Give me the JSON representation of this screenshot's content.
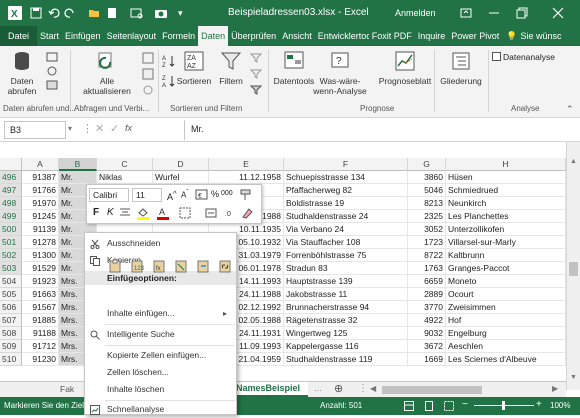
{
  "titlebar": {
    "filename": "Beispieladressen03.xlsx",
    "separator": "-",
    "app": "Excel",
    "signin": "Anmelden"
  },
  "tabs": [
    "Datei",
    "Start",
    "Einfügen",
    "Seitenlayout",
    "Formeln",
    "Daten",
    "Überprüfen",
    "Ansicht",
    "Entwicklertools",
    "Foxit PDF",
    "Inquire",
    "Power Pivot"
  ],
  "tellme": "Sie wünsc",
  "ribbon": {
    "get_data": "Daten abrufen",
    "refresh_all_line1": "Alle",
    "refresh_all_line2": "aktualisieren",
    "sort": "Sortieren",
    "filter": "Filtern",
    "datatools": "Datentools",
    "whatif_line1": "Was-wäre-",
    "whatif_line2": "wenn-Analyse",
    "forecast": "Prognoseblatt",
    "outline": "Gliederung",
    "dataanalysis": "Datenanalyse",
    "groups": [
      "Daten abrufen und...",
      "Abfragen und Verbi...",
      "Sortieren und Filtern",
      "Prognose",
      "Analyse"
    ]
  },
  "formulabar": {
    "namebox": "B3",
    "fx": "fx",
    "content": "Mr."
  },
  "columns": [
    "A",
    "B",
    "C",
    "D",
    "E",
    "F",
    "G",
    "H"
  ],
  "rows": [
    {
      "num": "496",
      "a": "91387",
      "b": "Mr.",
      "c": "Niklas",
      "d": "Wurfel",
      "e": "11.12.1958",
      "f": "Schuepisstrasse 134",
      "g": "3860",
      "h": "Hüsen"
    },
    {
      "num": "497",
      "a": "91766",
      "b": "Mr.",
      "c": "",
      "d": "",
      "e": "",
      "f": "Pfaffacherweg 82",
      "g": "5046",
      "h": "Schmiedrued"
    },
    {
      "num": "498",
      "a": "91970",
      "b": "Mr.",
      "c": "",
      "d": "",
      "e": "",
      "f": "Boldistrasse 19",
      "g": "8213",
      "h": "Neunkirch"
    },
    {
      "num": "499",
      "a": "91245",
      "b": "Mr.",
      "c": "Bernd",
      "d": "Zimmer",
      "e": "01.03.1988",
      "f": "Studhaldenstrasse 24",
      "g": "2325",
      "h": "Les Planchettes"
    },
    {
      "num": "500",
      "a": "91139",
      "b": "Mr.",
      "c": "",
      "d": "",
      "e": "10.11.1935",
      "f": "Via Verbano 24",
      "g": "3052",
      "h": "Unterzollikofen"
    },
    {
      "num": "501",
      "a": "91278",
      "b": "Mr.",
      "c": "",
      "d": "",
      "e": "05.10.1932",
      "f": "Via Stauffacher 108",
      "g": "1723",
      "h": "Villarsel-sur-Marly"
    },
    {
      "num": "502",
      "a": "91300",
      "b": "Mr.",
      "c": "",
      "d": "",
      "e": "31.03.1979",
      "f": "Forrenböhlstrasse 75",
      "g": "8722",
      "h": "Kaltbrunn"
    },
    {
      "num": "503",
      "a": "91529",
      "b": "Mr.",
      "c": "",
      "d": "",
      "e": "06.01.1978",
      "f": "Stradun 83",
      "g": "1763",
      "h": "Granges-Paccot"
    },
    {
      "num": "504",
      "a": "91923",
      "b": "Mrs.",
      "c": "",
      "d": "",
      "e": "14.11.1993",
      "f": "Hauptstrasse 139",
      "g": "6659",
      "h": "Moneto"
    },
    {
      "num": "505",
      "a": "91663",
      "b": "Mrs.",
      "c": "",
      "d": "",
      "e": "24.11.1988",
      "f": "Jakobstrasse 11",
      "g": "2889",
      "h": "Ocourt"
    },
    {
      "num": "506",
      "a": "91567",
      "b": "Mrs.",
      "c": "",
      "d": "",
      "e": "02.12.1992",
      "f": "Brunnacherstrasse 94",
      "g": "3770",
      "h": "Zweisimmen"
    },
    {
      "num": "507",
      "a": "91885",
      "b": "Mrs.",
      "c": "",
      "d": "",
      "e": "02.05.1988",
      "f": "Rägetenstrasse 32",
      "g": "4922",
      "h": "Hof"
    },
    {
      "num": "508",
      "a": "91188",
      "b": "Mrs.",
      "c": "",
      "d": "",
      "e": "24.11.1931",
      "f": "Wingertweg 125",
      "g": "9032",
      "h": "Engelburg"
    },
    {
      "num": "509",
      "a": "91712",
      "b": "Mrs.",
      "c": "",
      "d": "",
      "e": "11.09.1993",
      "f": "Kappelergasse 116",
      "g": "3672",
      "h": "Aeschlen"
    },
    {
      "num": "510",
      "a": "91230",
      "b": "Mrs.",
      "c": "",
      "d": "",
      "e": "21.04.1959",
      "f": "Studhaldenstrasse 119",
      "g": "1669",
      "h": "Les Sciernes d'Albeuve"
    }
  ],
  "minitoolbar": {
    "font": "Calibri",
    "size": "11",
    "bold": "F",
    "italic": "K",
    "percent": "%",
    "thousands": "000"
  },
  "contextmenu": {
    "cut": "Ausschneiden",
    "copy": "Kopieren",
    "paste_header": "Einfügeoptionen:",
    "paste_special": "Inhalte einfügen...",
    "smart_lookup": "Intelligente Suche",
    "insert_copied": "Kopierte Zellen einfügen...",
    "delete": "Zellen löschen...",
    "clear": "Inhalte löschen",
    "quick_analysis": "Schnellanalyse"
  },
  "sheets": {
    "partial": "Fak",
    "active": "NamesBeispiel"
  },
  "status": {
    "mode": "Markieren Sie den Ziel",
    "count": "Anzahl: 501",
    "zoom": "100%"
  },
  "colors": {
    "excel_green": "#217346",
    "header_gray": "#f3f3f3",
    "selection_gray": "#d9d9d9"
  }
}
